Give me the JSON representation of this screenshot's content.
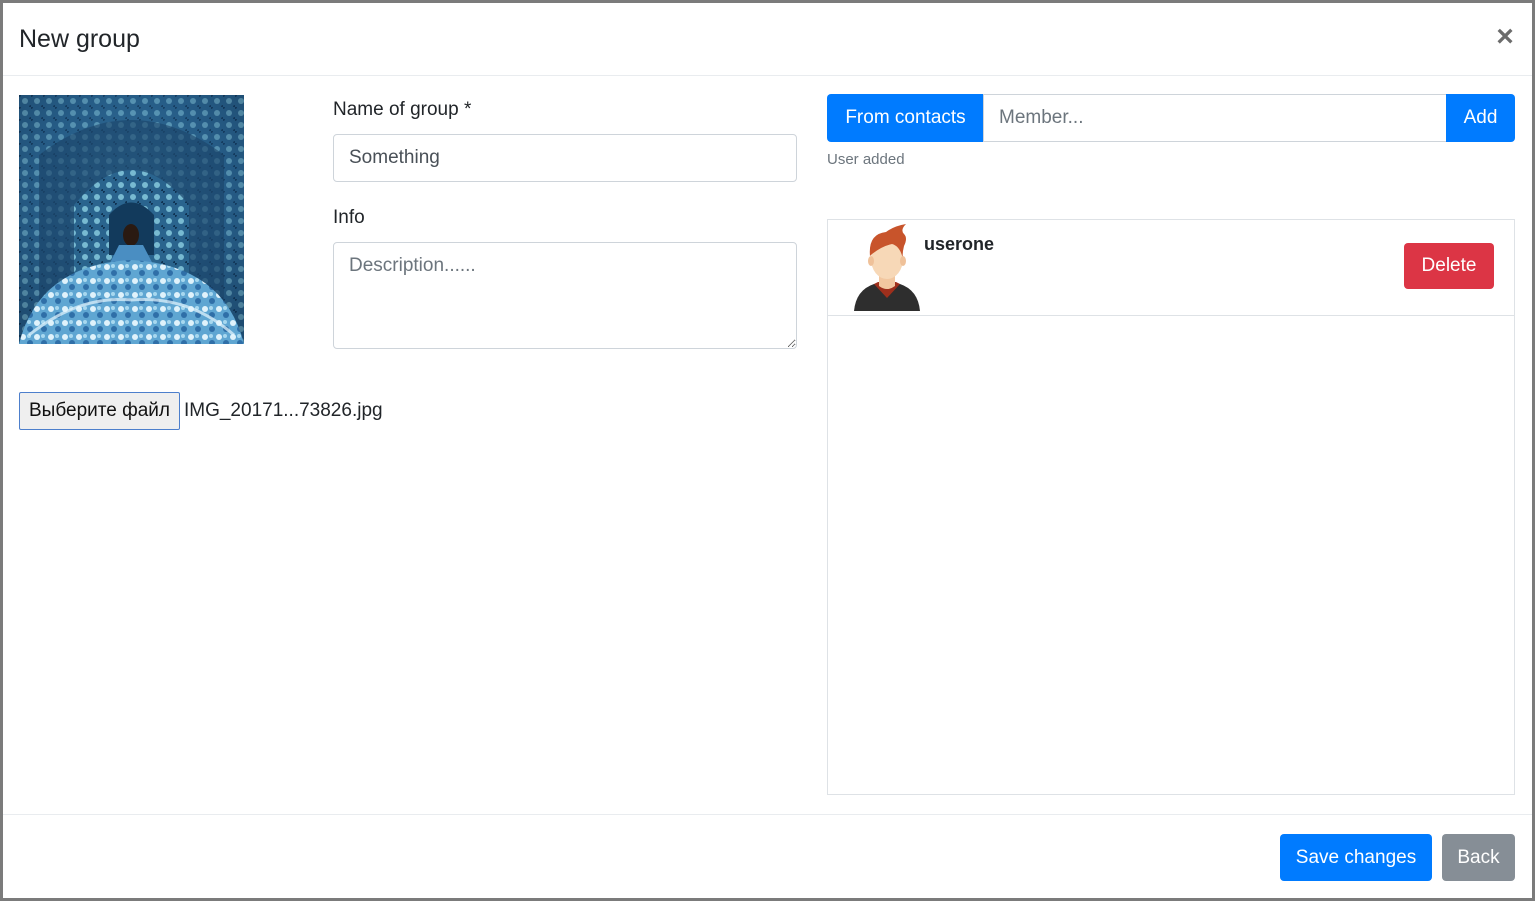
{
  "dialog": {
    "title": "New group",
    "close_symbol": "×"
  },
  "form": {
    "name_label": "Name of group *",
    "name_value": "Something",
    "info_label": "Info",
    "info_placeholder": "Description......",
    "file_button_label": "Выберите файл",
    "file_name": "IMG_20171...73826.jpg"
  },
  "members": {
    "from_contacts_label": "From contacts",
    "member_placeholder": "Member...",
    "add_label": "Add",
    "status_text": "User added",
    "list": [
      {
        "username": "userone",
        "delete_label": "Delete"
      }
    ]
  },
  "footer": {
    "save_label": "Save changes",
    "back_label": "Back"
  },
  "colors": {
    "primary": "#007bff",
    "danger": "#dc3545",
    "secondary": "#868e96"
  },
  "icons": {
    "close": "close-icon",
    "avatar": "user-avatar-icon",
    "group_photo": "group-photo-image"
  }
}
